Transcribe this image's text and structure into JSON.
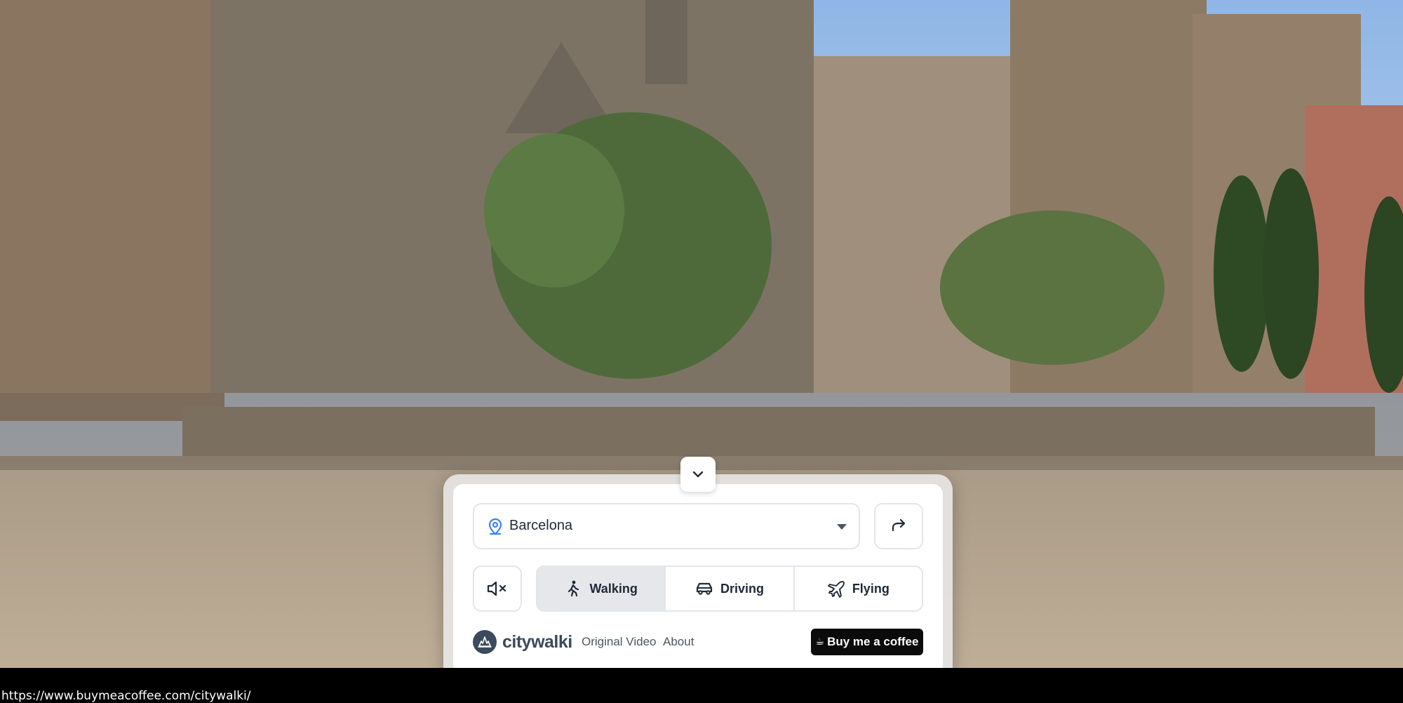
{
  "location": {
    "value": "Barcelona"
  },
  "modes": [
    {
      "label": "Walking",
      "active": true
    },
    {
      "label": "Driving",
      "active": false
    },
    {
      "label": "Flying",
      "active": false
    }
  ],
  "brand": {
    "name": "citywalki"
  },
  "footer": {
    "original_video": "Original Video",
    "about": "About",
    "coffee_label": "Buy me a coffee",
    "coffee_emoji": "☕"
  },
  "status_bar": {
    "url": "https://www.buymeacoffee.com/citywalki/"
  },
  "icons": {
    "collapse": "chevron-down-icon",
    "location": "map-pin-icon",
    "caret": "caret-down-icon",
    "share": "share-icon",
    "mute": "volume-mute-icon",
    "walking": "walking-person-icon",
    "driving": "car-icon",
    "flying": "plane-icon"
  },
  "colors": {
    "accent": "#3b82f6",
    "brand": "#3b4a5c",
    "active_mode_bg": "#e5e7eb",
    "coffee_bg": "#0b0b0b"
  }
}
